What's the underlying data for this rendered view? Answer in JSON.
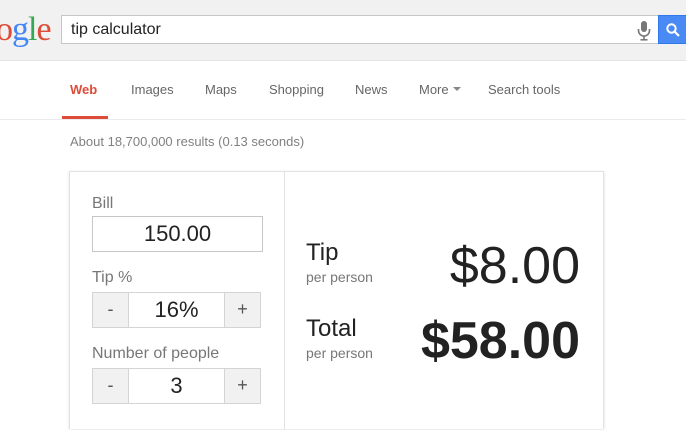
{
  "header": {
    "logo_letters": [
      {
        "char": "o",
        "color": "#dd4b39"
      },
      {
        "char": "g",
        "color": "#4285f4"
      },
      {
        "char": "l",
        "color": "#34a853"
      },
      {
        "char": "e",
        "color": "#dd4b39"
      }
    ],
    "search": {
      "value": "tip calculator",
      "accent": "#4a8af4"
    }
  },
  "nav": {
    "tabs": [
      {
        "label": "Web",
        "active": true
      },
      {
        "label": "Images"
      },
      {
        "label": "Maps"
      },
      {
        "label": "Shopping"
      },
      {
        "label": "News"
      },
      {
        "label": "More"
      },
      {
        "label": "Search tools"
      }
    ],
    "active_color": "#dd4b39"
  },
  "result_stats": "About 18,700,000 results (0.13 seconds)",
  "calculator": {
    "bill_label": "Bill",
    "bill_value": "150.00",
    "tip_label": "Tip %",
    "tip_value": "16%",
    "people_label": "Number of people",
    "people_value": "3",
    "minus_label": "-",
    "plus_label": "+",
    "tip_result_label": "Tip",
    "tip_result_sub": "per person",
    "tip_result_value": "$8.00",
    "total_result_label": "Total",
    "total_result_sub": "per person",
    "total_result_value": "$58.00"
  },
  "icons": {
    "mic": "microphone-icon",
    "search": "search-icon",
    "more_caret": "caret-down-icon"
  }
}
